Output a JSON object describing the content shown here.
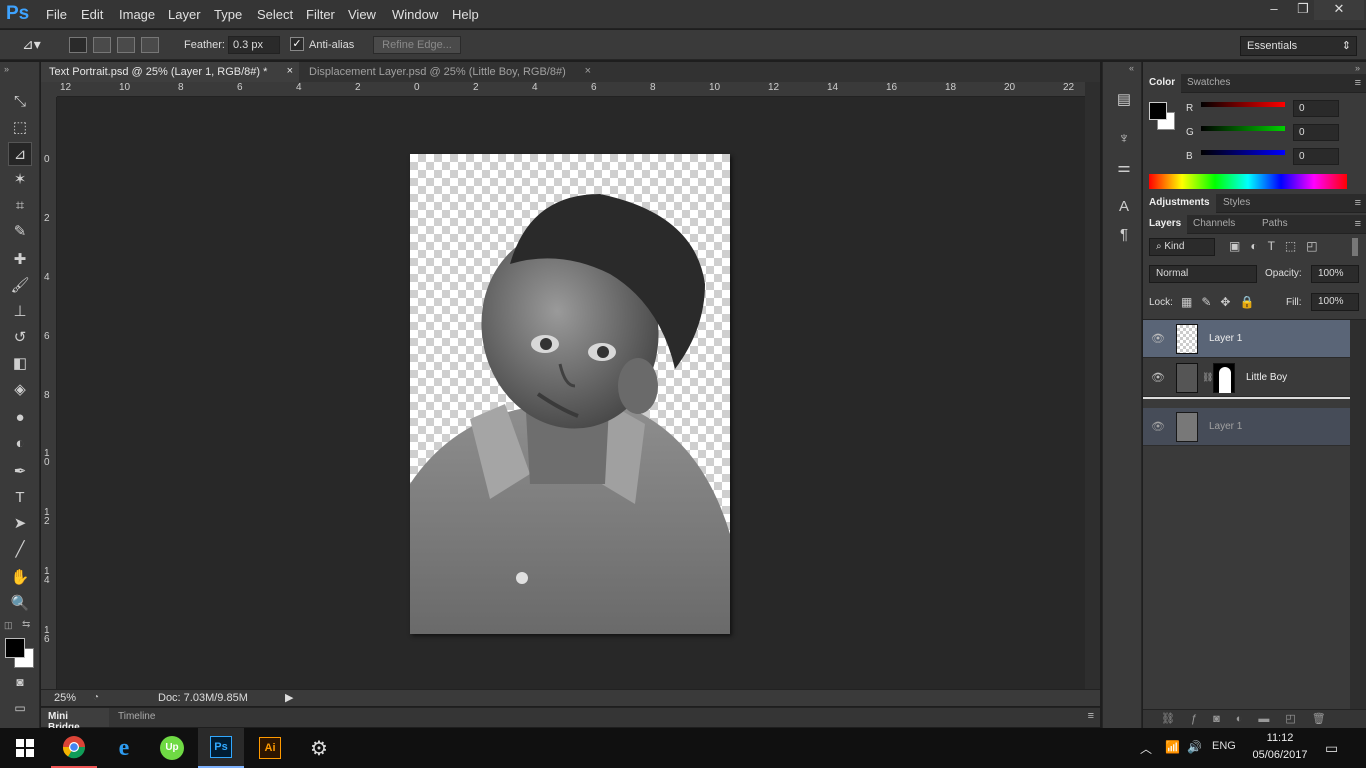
{
  "app": {
    "logo_text": "Ps"
  },
  "menu": [
    "File",
    "Edit",
    "Image",
    "Layer",
    "Type",
    "Select",
    "Filter",
    "View",
    "Window",
    "Help"
  ],
  "window_controls": {
    "minimize": "–",
    "restore": "❐",
    "close": "✕"
  },
  "options": {
    "feather_label": "Feather:",
    "feather_value": "0.3 px",
    "antialias_label": "Anti-alias",
    "antialias_checked": true,
    "refine_edge": "Refine Edge...",
    "workspace": "Essentials"
  },
  "documents": [
    {
      "title": "Text Portrait.psd @ 25% (Layer 1, RGB/8#) *",
      "active": true
    },
    {
      "title": "Displacement Layer.psd @ 25% (Little Boy, RGB/8#)",
      "active": false
    }
  ],
  "ruler_top": [
    "12",
    "10",
    "8",
    "6",
    "4",
    "2",
    "0",
    "2",
    "4",
    "6",
    "8",
    "10",
    "12",
    "14",
    "16",
    "18",
    "20",
    "22"
  ],
  "ruler_left": [
    "0",
    "2",
    "4",
    "6",
    "8",
    "1 0",
    "1 2",
    "1 4",
    "1 6"
  ],
  "status": {
    "zoom": "25%",
    "doc": "Doc: 7.03M/9.85M"
  },
  "bottom_tabs": [
    "Mini Bridge",
    "Timeline"
  ],
  "color_panel": {
    "tabs": [
      "Color",
      "Swatches"
    ],
    "channels": [
      {
        "label": "R",
        "value": "0",
        "color": "#ff0000"
      },
      {
        "label": "G",
        "value": "0",
        "color": "#00d000"
      },
      {
        "label": "B",
        "value": "0",
        "color": "#0000ff"
      }
    ]
  },
  "adjustments_tabs": [
    "Adjustments",
    "Styles"
  ],
  "layers_panel": {
    "tabs": [
      "Layers",
      "Channels",
      "Paths"
    ],
    "kind": "Kind",
    "blend_mode": "Normal",
    "opacity_label": "Opacity:",
    "opacity_value": "100%",
    "lock_label": "Lock:",
    "fill_label": "Fill:",
    "fill_value": "100%",
    "layers": [
      {
        "name": "Layer 1",
        "selected": true
      },
      {
        "name": "Little Boy",
        "selected": false
      },
      {
        "name": "Layer 1",
        "selected": false,
        "dragging": true
      }
    ]
  },
  "taskbar": {
    "apps": [
      "chrome",
      "internet-explorer",
      "upwork",
      "photoshop",
      "illustrator",
      "steam"
    ],
    "ps_label": "Ps",
    "ai_label": "Ai",
    "up_label": "Up",
    "lang": "ENG",
    "time": "11:12",
    "date": "05/06/2017"
  }
}
